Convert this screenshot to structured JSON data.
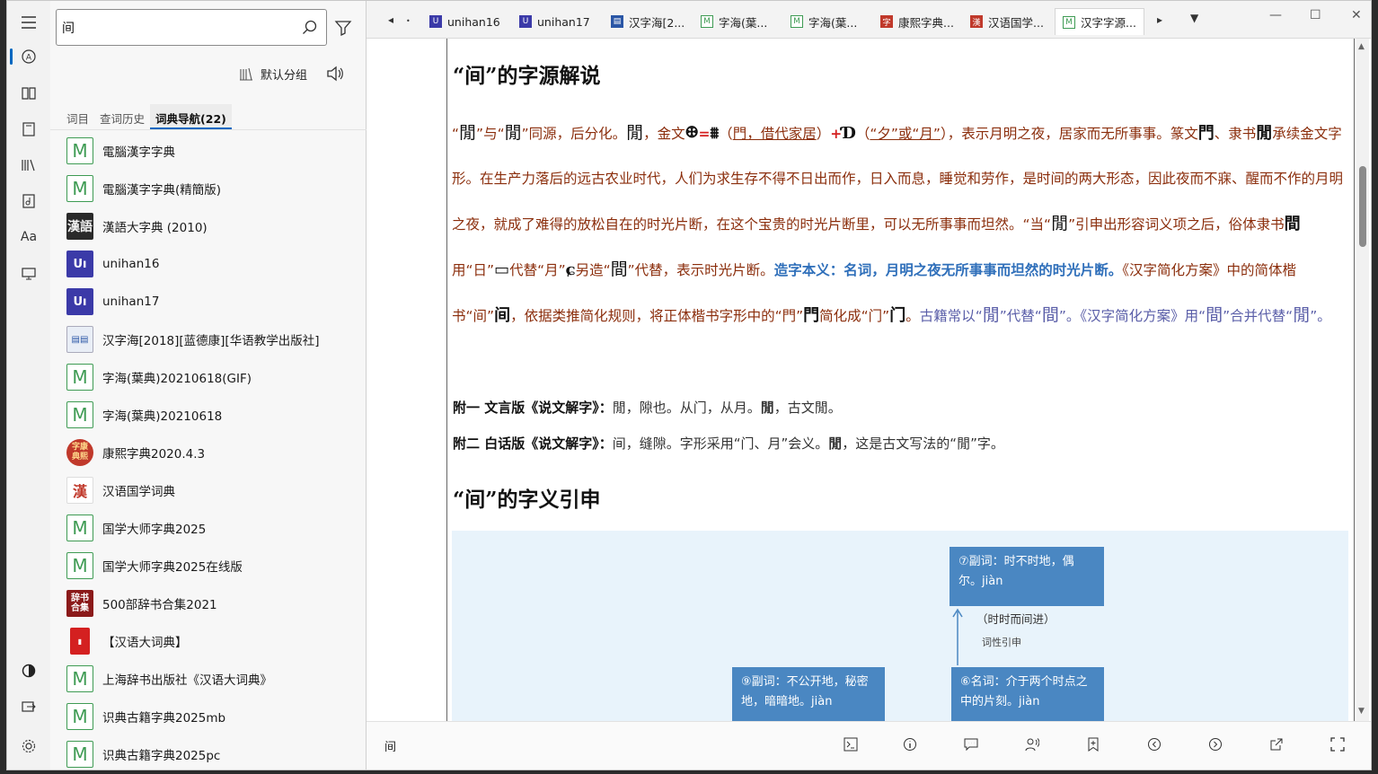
{
  "search": {
    "value": "间",
    "placeholder": ""
  },
  "sidebar": {
    "group_label": "默认分组",
    "tabs": [
      "词目",
      "查词历史",
      "词典导航(22)"
    ],
    "dicts": [
      {
        "name": "電腦漢字字典",
        "icon": "m"
      },
      {
        "name": "電腦漢字字典(精簡版)",
        "icon": "m"
      },
      {
        "name": "漢語大字典 (2010)",
        "icon": "han"
      },
      {
        "name": "unihan16",
        "icon": "uni"
      },
      {
        "name": "unihan17",
        "icon": "uni"
      },
      {
        "name": "汉字海[2018][蓝德康][华语教学出版社]",
        "icon": "hai"
      },
      {
        "name": "字海(葉典)20210618(GIF)",
        "icon": "m"
      },
      {
        "name": "字海(葉典)20210618",
        "icon": "m"
      },
      {
        "name": "康熙字典2020.4.3",
        "icon": "kang"
      },
      {
        "name": "汉语国学词典",
        "icon": "guo"
      },
      {
        "name": "国学大师字典2025",
        "icon": "m"
      },
      {
        "name": "国学大师字典2025在线版",
        "icon": "m"
      },
      {
        "name": "500部辞书合集2021",
        "icon": "cishu"
      },
      {
        "name": "【汉语大词典】",
        "icon": "red"
      },
      {
        "name": "上海辞书出版社《汉语大词典》",
        "icon": "m"
      },
      {
        "name": "识典古籍字典2025mb",
        "icon": "m"
      },
      {
        "name": "识典古籍字典2025pc",
        "icon": "m"
      }
    ]
  },
  "tabbar": {
    "tabs": [
      {
        "label": "unihan16",
        "icon": "uni"
      },
      {
        "label": "unihan17",
        "icon": "uni"
      },
      {
        "label": "汉字海[2...",
        "icon": "hai"
      },
      {
        "label": "字海(葉...",
        "icon": "m"
      },
      {
        "label": "字海(葉...",
        "icon": "m"
      },
      {
        "label": "康熙字典...",
        "icon": "kang"
      },
      {
        "label": "汉语国学...",
        "icon": "guo"
      },
      {
        "label": "汉字字源...",
        "icon": "m"
      }
    ]
  },
  "content": {
    "h1": "“间”的字源解说",
    "h2": "“间”的字义引申",
    "para": {
      "p1a": "“",
      "p1b": "閒",
      "p1c": "”与“",
      "p1d": "閒",
      "p1e": "”同源，后分化。",
      "p1f": "閒",
      "p1g": "，金文",
      "p1h": "=",
      "p1i": "（",
      "p1j": "門，借代家居",
      "p1k": "）",
      "p1l": "+",
      "p1m": "（",
      "p1n": "“夕”或“月”",
      "p1o": "），表示月明之夜，居家而无所事事。篆文",
      "p1p": "、隶书",
      "p1q": "承续金文字形。在生产力落后的远古农业时代，人们为求生存不得不日出而作，日入而息，睡觉和劳作，是时间的两大形态，因此夜而不寐、醒而不作的月明之夜，就成了难得的放松自在的时光片断，在这个宝贵的时光片断里，可以无所事事而坦然。“当“",
      "p1r": "閒",
      "p1s": "”引申出形容词义项之后，俗体隶书",
      "p1t": "用“日”",
      "p1u": "代替“月”",
      "p1v": "另造“",
      "p1w": "間",
      "p1x": "”代替，表示时光片断。",
      "p1y": "造字本义：名词，月明之夜无所事事而坦然的时光片断。",
      "p1z": "《汉字简化方案》中的简体楷书“间”",
      "p2a": "，依据类推简化规则，将正体楷书字形中的“門”",
      "p2b": "简化成“门”",
      "p2c": "。",
      "p2d": "古籍常以“",
      "p2e": "閒",
      "p2f": "”代替“",
      "p2g": "間",
      "p2h": "”。《汉字简化方案》用“",
      "p2i": "間",
      "p2j": "”合并代替“",
      "p2k": "閒",
      "p2l": "”。"
    },
    "appendix1": {
      "label": "附一 文言版《说文解字》：",
      "text": "閒，隙也。从门，从月。",
      "tail": "，古文閒。"
    },
    "appendix2": {
      "label": "附二 白话版《说文解字》：",
      "text": "间，缝隙。字形采用“门、月”会义。",
      "tail": "，这是古文写法的“閒”字。"
    },
    "diagram": {
      "box7": "⑦副词：时不时地，偶尔。jiàn",
      "note1": "（时时而间进）",
      "note2": "词性引申",
      "box9": "⑨副词：不公开地，秘密地，暗暗地。jiàn",
      "box6": "⑥名词：介于两个时点之中的片刻。jiàn"
    }
  },
  "bottombar": {
    "word": "间"
  },
  "colors": {
    "accent": "#0067c0",
    "text_brown": "#8b2e0c",
    "text_blue": "#2f6fba",
    "diagram_box": "#4a87c2",
    "diagram_bg": "#e8f3fb"
  }
}
